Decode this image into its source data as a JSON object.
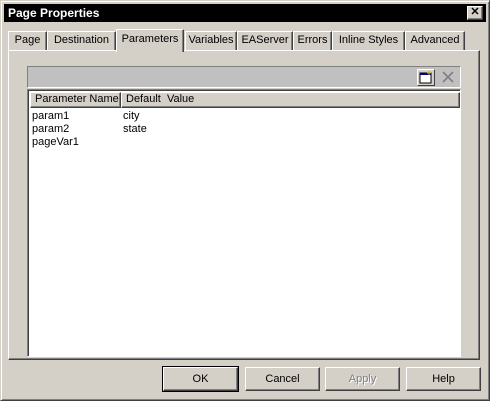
{
  "window": {
    "title": "Page Properties",
    "close_glyph": "✕"
  },
  "tabs": [
    {
      "label": "Page"
    },
    {
      "label": "Destination"
    },
    {
      "label": "Parameters"
    },
    {
      "label": "Variables"
    },
    {
      "label": "EAServer"
    },
    {
      "label": "Errors"
    },
    {
      "label": "Inline Styles"
    },
    {
      "label": "Advanced"
    }
  ],
  "active_tab": "Parameters",
  "toolbar": {
    "add_icon": "new-row-icon",
    "delete_icon": "delete-row-icon"
  },
  "list": {
    "columns": [
      "Parameter Name",
      "Default  Value"
    ],
    "rows": [
      [
        "param1",
        "city"
      ],
      [
        "param2",
        "state"
      ],
      [
        "pageVar1",
        ""
      ]
    ]
  },
  "buttons": {
    "ok": "OK",
    "cancel": "Cancel",
    "apply": "Apply",
    "help": "Help"
  }
}
